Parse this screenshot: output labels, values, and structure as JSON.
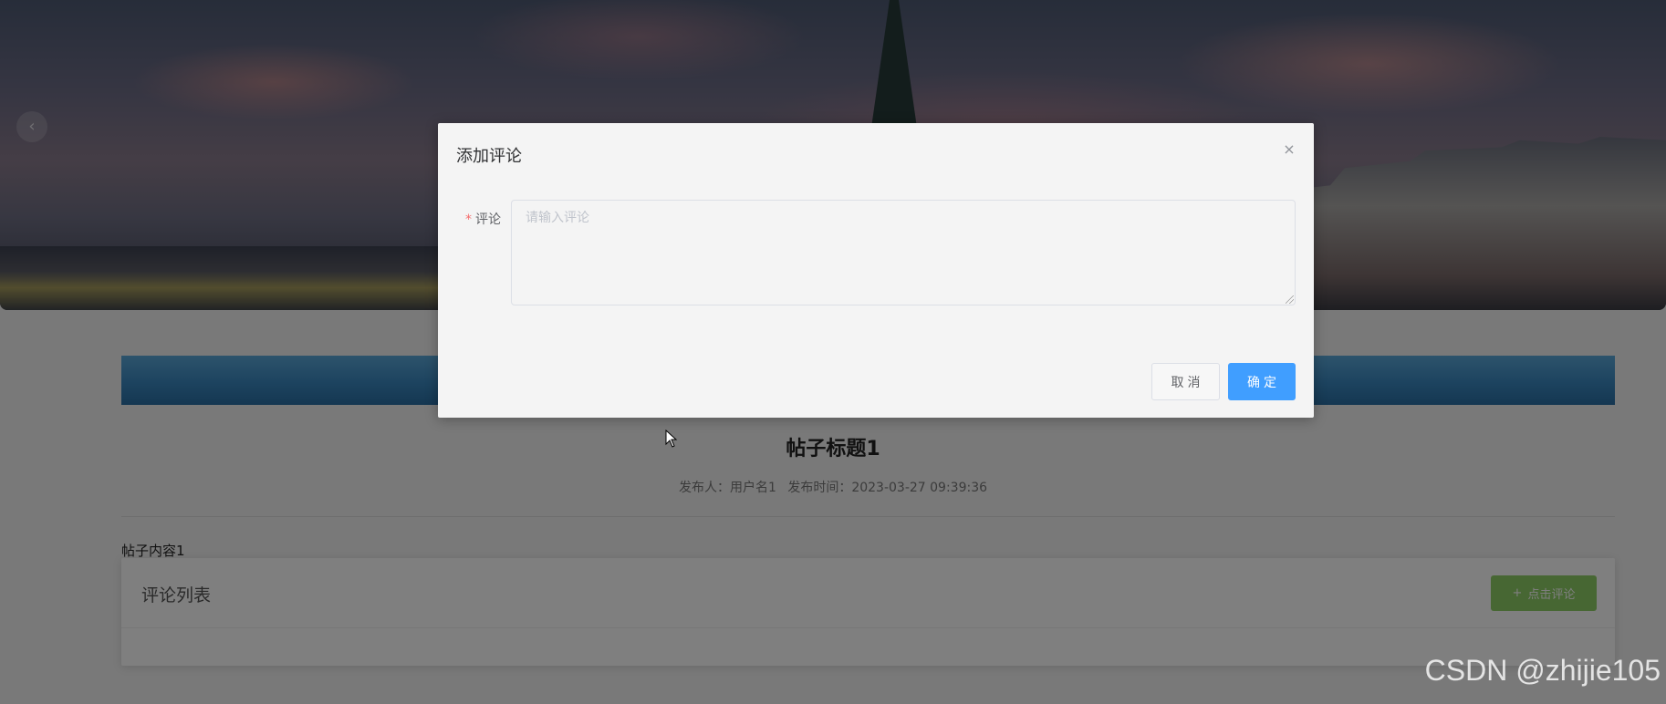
{
  "banner": {
    "prev_icon": "‹"
  },
  "post": {
    "title": "帖子标题1",
    "meta": {
      "author_label": "发布人：",
      "author": "用户名1",
      "time_label": "发布时间：",
      "time": "2023-03-27 09:39:36"
    },
    "content": "帖子内容1"
  },
  "comments": {
    "title": "评论列表",
    "add_button": {
      "icon": "+",
      "label": "点击评论"
    }
  },
  "dialog": {
    "title": "添加评论",
    "close_icon": "×",
    "field": {
      "required_mark": "*",
      "label": "评论",
      "value": "",
      "placeholder": "请输入评论"
    },
    "cancel_label": "取消",
    "confirm_label": "确定"
  },
  "watermark": "CSDN @zhijie105",
  "colors": {
    "primary": "#409eff",
    "success_button": "#8fce66",
    "required": "#f56c6c",
    "header_bar": "#3a87bf"
  }
}
